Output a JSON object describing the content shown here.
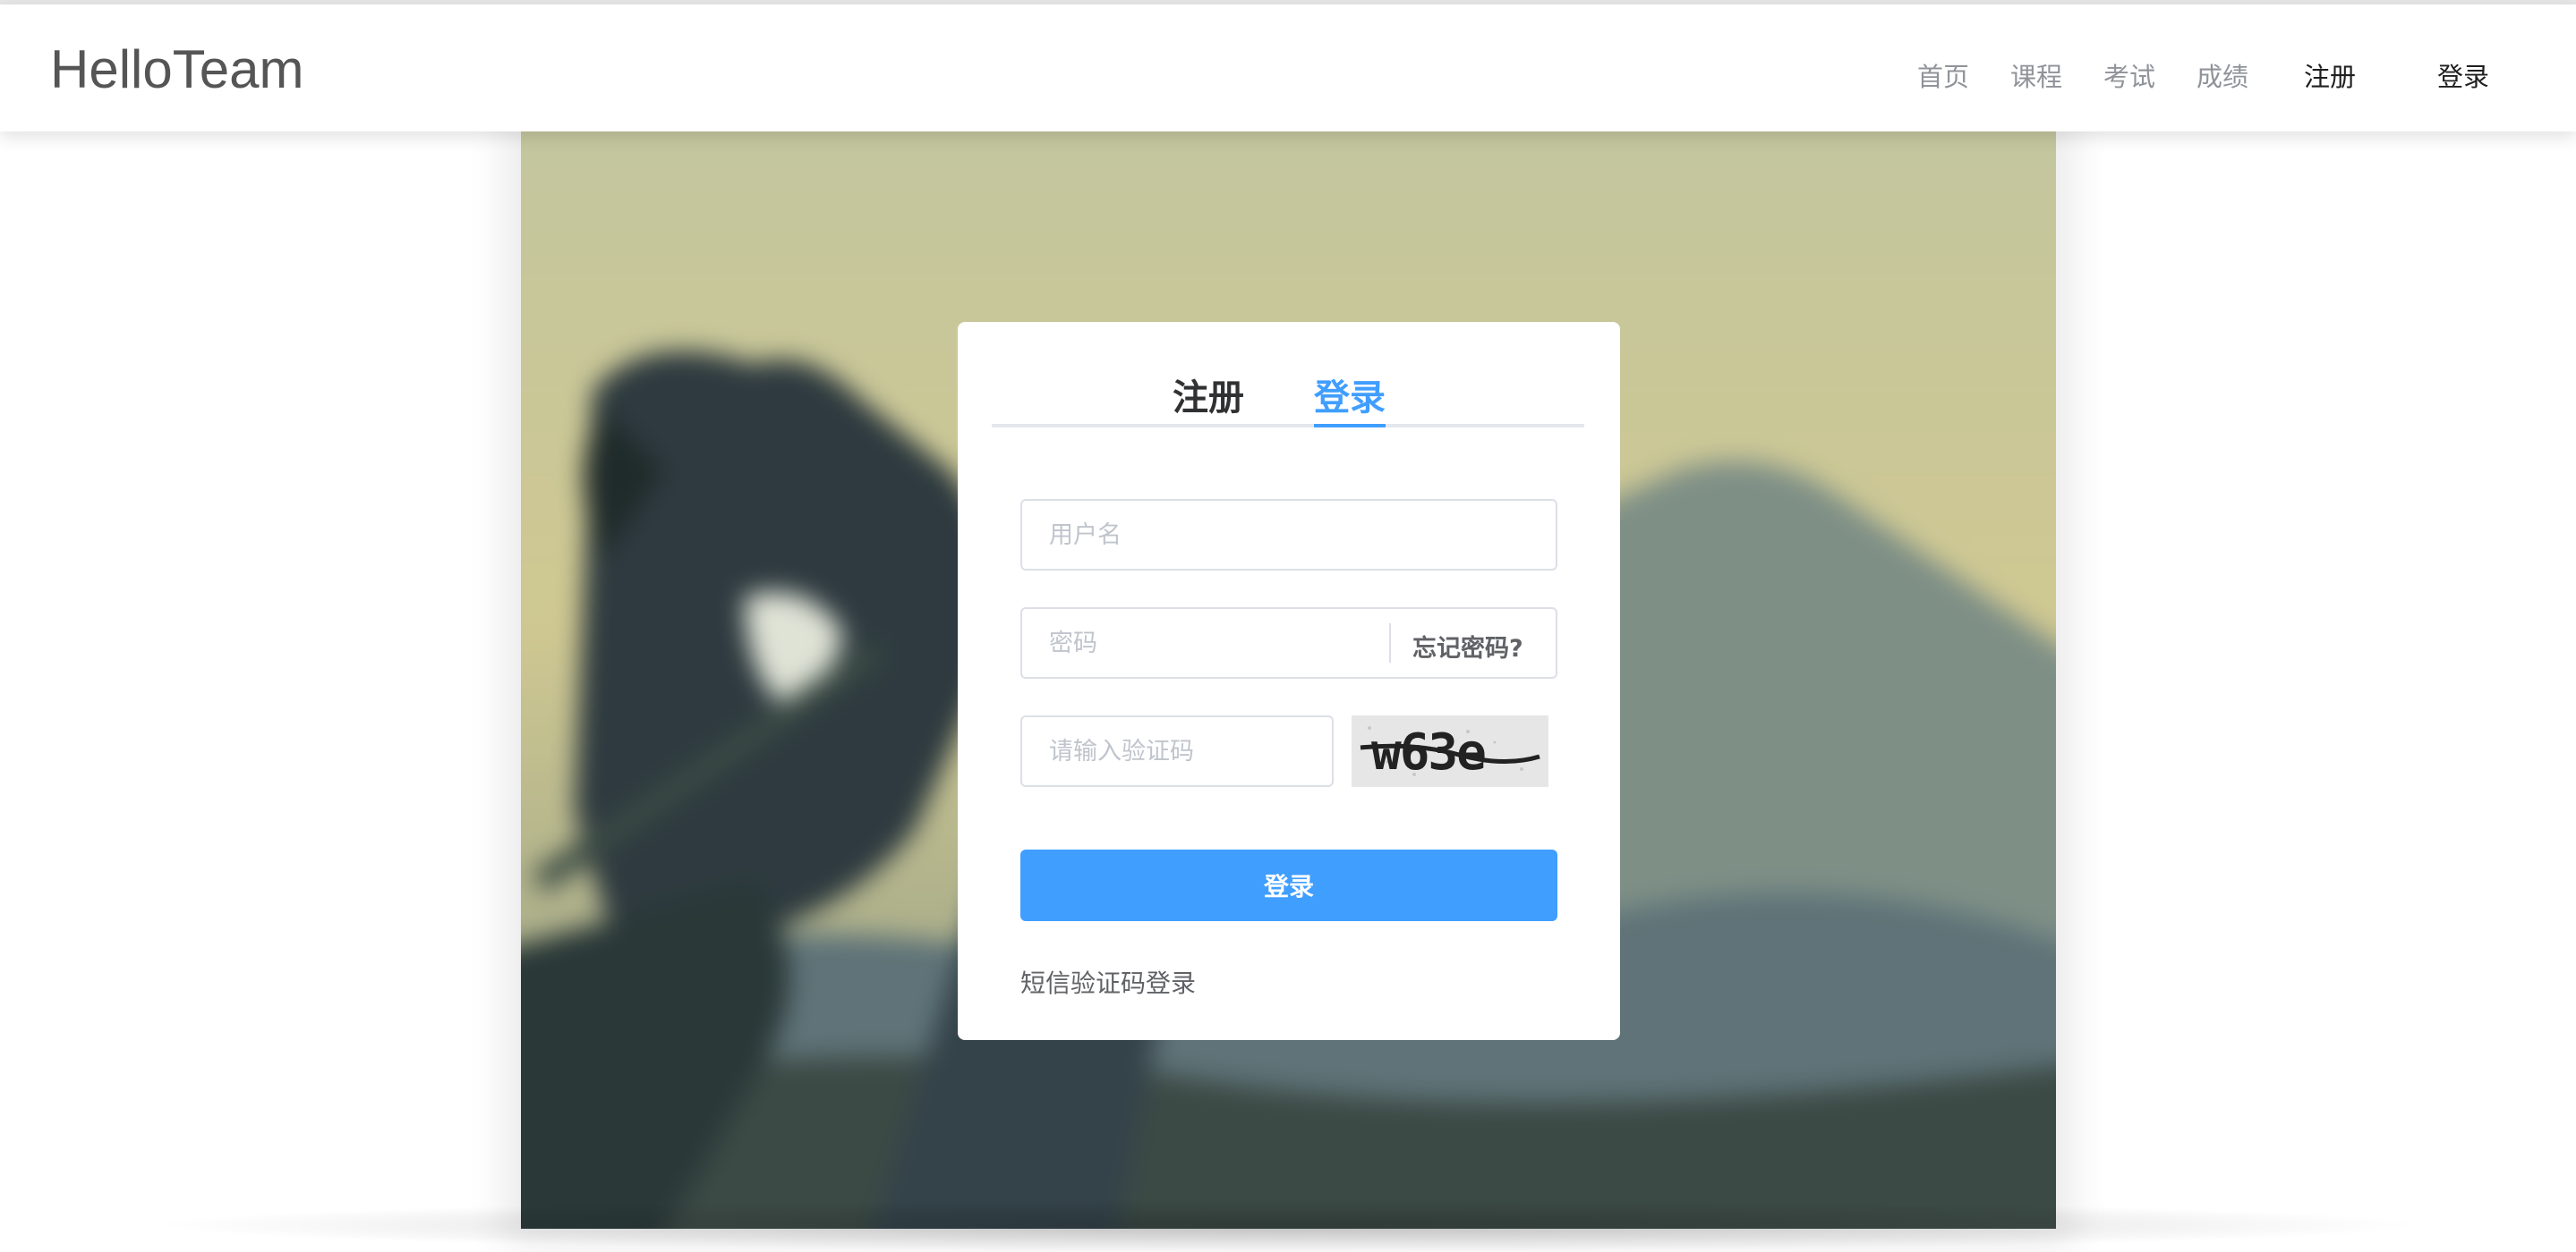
{
  "header": {
    "logo": "HelloTeam",
    "nav": [
      {
        "label": "首页"
      },
      {
        "label": "课程"
      },
      {
        "label": "考试"
      },
      {
        "label": "成绩"
      }
    ],
    "register_label": "注册",
    "login_label": "登录"
  },
  "login_card": {
    "tabs": [
      {
        "label": "注册",
        "active": false
      },
      {
        "label": "登录",
        "active": true
      }
    ],
    "username": {
      "placeholder": "用户名",
      "value": ""
    },
    "password": {
      "placeholder": "密码",
      "value": ""
    },
    "forgot_label": "忘记密码?",
    "captcha": {
      "placeholder": "请输入验证码",
      "value": "",
      "image_text": "w63e"
    },
    "submit_label": "登录",
    "sms_login_label": "短信验证码登录"
  },
  "colors": {
    "accent": "#409eff",
    "nav_text": "#909399",
    "logo": "#555555"
  }
}
